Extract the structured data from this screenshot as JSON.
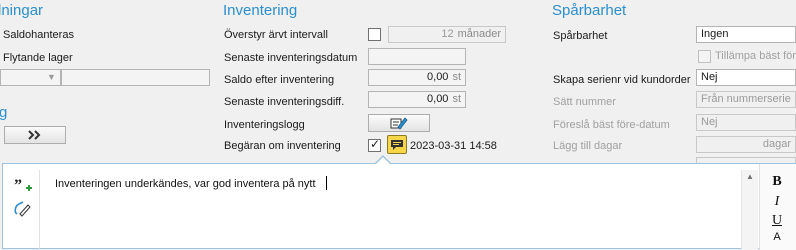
{
  "left_section": {
    "title": "lningar",
    "saldohanteras": "Saldohanteras",
    "flytande_lager": "Flytande lager",
    "section2_title": "g",
    "next_button_icon": "double-chevron-right-icon"
  },
  "inventory": {
    "title": "Inventering",
    "override_label": "Överstyr ärvt intervall",
    "override_value": "12",
    "override_unit": "månader",
    "last_date_label": "Senaste inventeringsdatum",
    "last_date_value": "",
    "balance_label": "Saldo efter inventering",
    "balance_value": "0,00",
    "balance_unit": "st",
    "diff_label": "Senaste inventeringsdiff.",
    "diff_value": "0,00",
    "diff_unit": "st",
    "log_label": "Inventeringslogg",
    "request_label": "Begäran om inventering",
    "request_timestamp": "2023-03-31 14:58"
  },
  "traceability": {
    "title": "Spårbarhet",
    "trace_label": "Spårbarhet",
    "trace_value": "Ingen",
    "apply_best_before": "Tillämpa bäst före",
    "create_serial_label": "Skapa serienr vid kundorder",
    "create_serial_value": "Nej",
    "set_number_label": "Sätt nummer",
    "set_number_value": "Från nummerserie",
    "suggest_bb_label": "Föreslå bäst före-datum",
    "suggest_bb_value": "Nej",
    "add_days_label": "Lägg till dagar",
    "add_days_unit": "dagar"
  },
  "note": {
    "text": "Inventeringen underkändes, var god inventera på nytt",
    "bold": "B",
    "italic": "I",
    "underline": "U",
    "font_a": "A"
  },
  "colors": {
    "accent": "#2a8fd0",
    "note_icon_bg": "#f7d64a"
  }
}
